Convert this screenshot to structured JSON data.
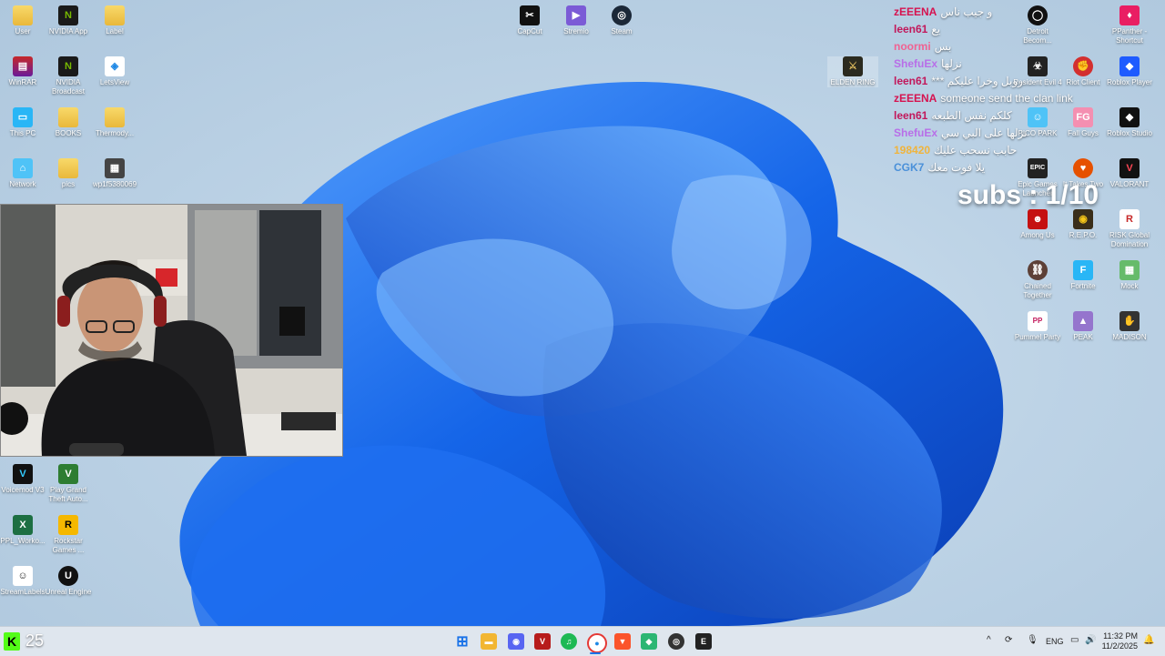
{
  "desktop": {
    "icons_left": [
      {
        "label": "User",
        "name": "user-folder-icon"
      },
      {
        "label": "NVIDIA App",
        "name": "nvidia-app-icon"
      },
      {
        "label": "Label",
        "name": "label-folder-icon"
      },
      {
        "label": "WinRAR",
        "name": "winrar-icon"
      },
      {
        "label": "NVIDIA Broadcast",
        "name": "nvidia-broadcast-icon"
      },
      {
        "label": "LetsView",
        "name": "letsview-icon"
      },
      {
        "label": "This PC",
        "name": "this-pc-icon"
      },
      {
        "label": "BOOKS",
        "name": "books-folder-icon"
      },
      {
        "label": "Thermody...",
        "name": "thermody-folder-icon"
      },
      {
        "label": "Network",
        "name": "network-icon"
      },
      {
        "label": "pics",
        "name": "pics-folder-icon"
      },
      {
        "label": "wp1f5380069",
        "name": "wallpaper-file-icon"
      },
      {
        "label": "Voicemod V3",
        "name": "voicemod-icon"
      },
      {
        "label": "Play Grand Theft Auto...",
        "name": "gta-icon"
      },
      {
        "label": "PPL_Worko...",
        "name": "excel-file-icon"
      },
      {
        "label": "Rockstar Games ...",
        "name": "rockstar-icon"
      },
      {
        "label": "StreamLabels",
        "name": "streamlabels-icon"
      },
      {
        "label": "Unreal Engine",
        "name": "unreal-engine-icon"
      }
    ],
    "icons_top": [
      {
        "label": "CapCut",
        "name": "capcut-icon"
      },
      {
        "label": "Stremio",
        "name": "stremio-icon"
      },
      {
        "label": "Steam",
        "name": "steam-icon"
      },
      {
        "label": "ELDEN RING",
        "name": "elden-ring-icon"
      }
    ],
    "icons_right": [
      {
        "label": "Detroit Becom...",
        "name": "detroit-icon"
      },
      {
        "label": "PPanther - Shortcut",
        "name": "ppanther-icon"
      },
      {
        "label": "Resident Evil 4",
        "name": "resident-evil-icon"
      },
      {
        "label": "Riot Client",
        "name": "riot-client-icon"
      },
      {
        "label": "Roblox Player",
        "name": "roblox-player-icon"
      },
      {
        "label": "PICO PARK",
        "name": "pico-park-icon"
      },
      {
        "label": "Fall Guys",
        "name": "fall-guys-icon"
      },
      {
        "label": "Roblox Studio",
        "name": "roblox-studio-icon"
      },
      {
        "label": "Epic Games Launcher",
        "name": "epic-games-icon"
      },
      {
        "label": "It Takes Two",
        "name": "it-takes-two-icon"
      },
      {
        "label": "VALORANT",
        "name": "valorant-icon"
      },
      {
        "label": "Among Us",
        "name": "among-us-icon"
      },
      {
        "label": "R.E.P.O.",
        "name": "repo-icon"
      },
      {
        "label": "RISK Global Domination",
        "name": "risk-icon"
      },
      {
        "label": "Chained Together",
        "name": "chained-together-icon"
      },
      {
        "label": "Fortnite",
        "name": "fortnite-icon"
      },
      {
        "label": "Mock",
        "name": "mock-icon"
      },
      {
        "label": "Pummel Party",
        "name": "pummel-party-icon"
      },
      {
        "label": "PEAK",
        "name": "peak-icon"
      },
      {
        "label": "MADISON",
        "name": "madison-icon"
      }
    ]
  },
  "chat": [
    {
      "user": "zEEENA",
      "color": "#d6124f",
      "msg": "و جيب ناس"
    },
    {
      "user": "leen61",
      "color": "#c2185b",
      "msg": "يع"
    },
    {
      "user": "noormi",
      "color": "#f06292",
      "msg": "بس"
    },
    {
      "user": "ShefuEx",
      "color": "#b86ee8",
      "msg": "نزلها"
    },
    {
      "user": "leen61",
      "color": "#c2185b",
      "msg": "*** روبل وخرا عليكم"
    },
    {
      "user": "zEEENA",
      "color": "#d6124f",
      "msg": "someone send the clan link"
    },
    {
      "user": "leen61",
      "color": "#c2185b",
      "msg": "كلكم نفس الطبعه"
    },
    {
      "user": "ShefuEx",
      "color": "#b86ee8",
      "msg": "نزلها على البي سي"
    },
    {
      "user": "198420",
      "color": "#f0b43c",
      "msg": "حابب نسحب عليك"
    },
    {
      "user": "CGK7",
      "color": "#4a90d9",
      "msg": "يلا فوت معك"
    }
  ],
  "overlay": {
    "subs_text": "subs : 1/10",
    "viewer_count": "25"
  },
  "taskbar": {
    "apps": [
      {
        "name": "start-button",
        "glyph": "⊞",
        "color": "#1a73e8"
      },
      {
        "name": "file-explorer-icon",
        "glyph": "▬",
        "color": "#f2b632"
      },
      {
        "name": "discord-icon",
        "glyph": "◉",
        "color": "#5865f2"
      },
      {
        "name": "voicemeeter-icon",
        "glyph": "V",
        "color": "#b71c1c"
      },
      {
        "name": "spotify-icon",
        "glyph": "♫",
        "color": "#1db954"
      },
      {
        "name": "chrome-icon",
        "glyph": "●",
        "color": "#e53935"
      },
      {
        "name": "brave-icon",
        "glyph": "▼",
        "color": "#fb542b"
      },
      {
        "name": "gamepad-app-icon",
        "glyph": "◆",
        "color": "#2bb673"
      },
      {
        "name": "obs-icon",
        "glyph": "◎",
        "color": "#333333"
      },
      {
        "name": "epic-taskbar-icon",
        "glyph": "E",
        "color": "#222222"
      }
    ],
    "tray": {
      "chevron": "^",
      "language": "ENG",
      "time": "11:32 PM",
      "date": "11/2/2025"
    }
  }
}
